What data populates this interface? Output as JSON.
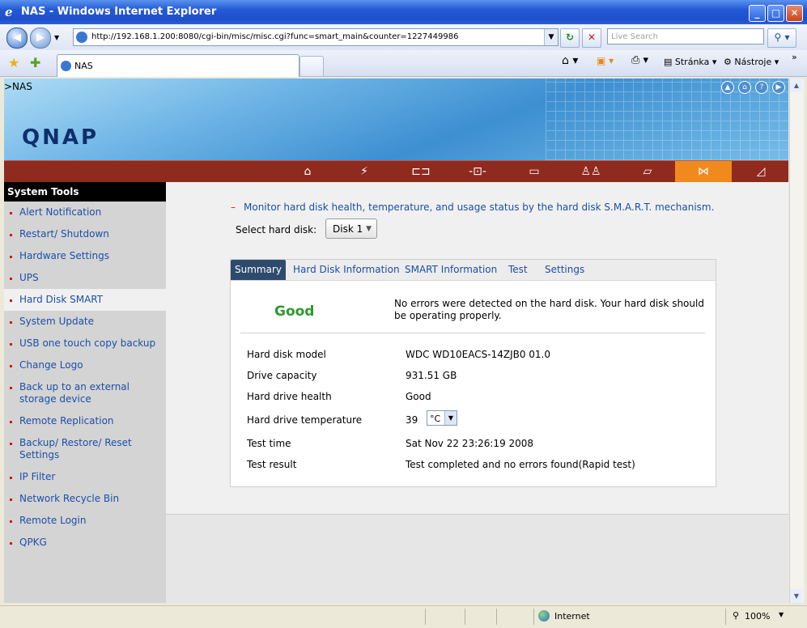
{
  "window": {
    "title": "NAS - Windows Internet Explorer",
    "min": "_",
    "max": "□",
    "close": "✕"
  },
  "address": {
    "url": "http://192.168.1.200:8080/cgi-bin/misc/misc.cgi?func=smart_main&counter=1227449986",
    "search_placeholder": "Live Search"
  },
  "tab": {
    "title": "NAS"
  },
  "toolbar": {
    "page": "Stránka",
    "tools": "Nástroje"
  },
  "banner": {
    "breadcrumb": ">NAS",
    "logo": "QNAP"
  },
  "sidebar": {
    "header": "System Tools",
    "items": [
      "Alert Notification",
      "Restart/ Shutdown",
      "Hardware Settings",
      "UPS",
      "Hard Disk SMART",
      "System Update",
      "USB one touch copy backup",
      "Change Logo",
      "Back up to an external storage device",
      "Remote Replication",
      "Backup/ Restore/ Reset Settings",
      "IP Filter",
      "Network Recycle Bin",
      "Remote Login",
      "QPKG"
    ],
    "selected_index": 4
  },
  "main": {
    "description": "Monitor hard disk health, temperature, and usage status by the hard disk S.M.A.R.T. mechanism.",
    "select_label": "Select hard disk:",
    "selected_disk": "Disk 1",
    "tabs": [
      "Summary",
      "Hard Disk Information",
      "SMART Information",
      "Test",
      "Settings"
    ],
    "status": "Good",
    "status_message": "No errors were detected on the hard disk. Your hard disk should be operating properly.",
    "rows": [
      {
        "label": "Hard disk model",
        "value": "WDC WD10EACS-14ZJB0 01.0"
      },
      {
        "label": "Drive capacity",
        "value": "931.51 GB"
      },
      {
        "label": "Hard drive health",
        "value": "Good"
      },
      {
        "label": "Hard drive temperature",
        "value": "39"
      },
      {
        "label": "Test time",
        "value": "Sat Nov 22 23:26:19 2008"
      },
      {
        "label": "Test result",
        "value": "Test completed and no errors found(Rapid test)"
      }
    ],
    "temp_unit": "°C"
  },
  "statusbar": {
    "zone": "Internet",
    "zoom": "100%"
  }
}
